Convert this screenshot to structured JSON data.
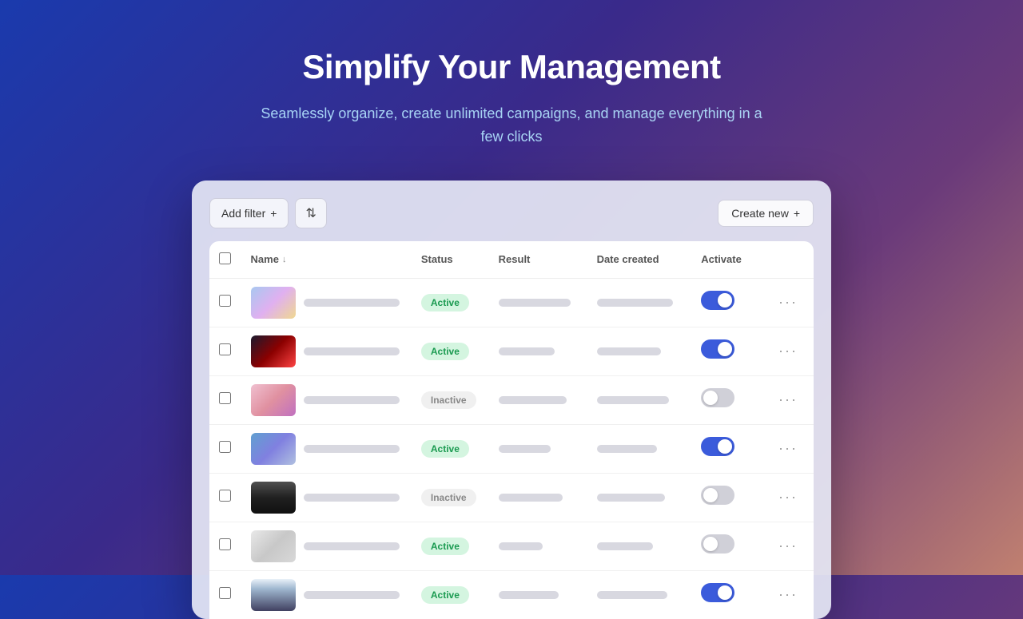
{
  "hero": {
    "title": "Simplify Your Management",
    "subtitle": "Seamlessly organize, create unlimited campaigns, and manage everything in a few clicks"
  },
  "toolbar": {
    "add_filter_label": "Add filter",
    "add_filter_icon": "+",
    "sort_icon": "⇅",
    "create_new_label": "Create new",
    "create_new_icon": "+"
  },
  "table": {
    "headers": {
      "name": "Name",
      "status": "Status",
      "result": "Result",
      "date_created": "Date created",
      "activate": "Activate"
    },
    "rows": [
      {
        "id": 1,
        "thumb": "thumb-gradient-1",
        "status": "Active",
        "toggle_on": true
      },
      {
        "id": 2,
        "thumb": "thumb-gradient-2",
        "status": "Active",
        "toggle_on": true
      },
      {
        "id": 3,
        "thumb": "thumb-gradient-3",
        "status": "Inactive",
        "toggle_on": false
      },
      {
        "id": 4,
        "thumb": "thumb-gradient-4",
        "status": "Active",
        "toggle_on": true
      },
      {
        "id": 5,
        "thumb": "thumb-gradient-5",
        "status": "Inactive",
        "toggle_on": false
      },
      {
        "id": 6,
        "thumb": "thumb-gradient-6",
        "status": "Active",
        "toggle_on": false
      },
      {
        "id": 7,
        "thumb": "thumb-gradient-7",
        "status": "Active",
        "toggle_on": true
      }
    ]
  }
}
